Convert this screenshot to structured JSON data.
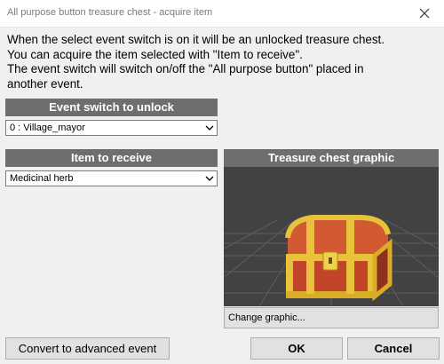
{
  "window": {
    "title": "All purpose button treasure chest - acquire item",
    "close_icon": "close-icon"
  },
  "description": {
    "lines": [
      "When the select event switch is on it will be an unlocked treasure chest.",
      "You can acquire the item selected with \"Item to receive\".",
      "The event switch will switch on/off the \"All purpose button\" placed in",
      "another event."
    ]
  },
  "event_switch": {
    "header": "Event switch to unlock",
    "selected": "0 : Village_mayor"
  },
  "item": {
    "header": "Item to receive",
    "selected": "Medicinal herb"
  },
  "graphic": {
    "header": "Treasure chest graphic",
    "change_label": "Change graphic..."
  },
  "buttons": {
    "convert": "Convert to advanced event",
    "ok": "OK",
    "cancel": "Cancel"
  },
  "colors": {
    "header_bg": "#6e6e6e",
    "preview_bg": "#424242",
    "chest_wood": "#c8482a",
    "chest_trim": "#e8c23a"
  }
}
